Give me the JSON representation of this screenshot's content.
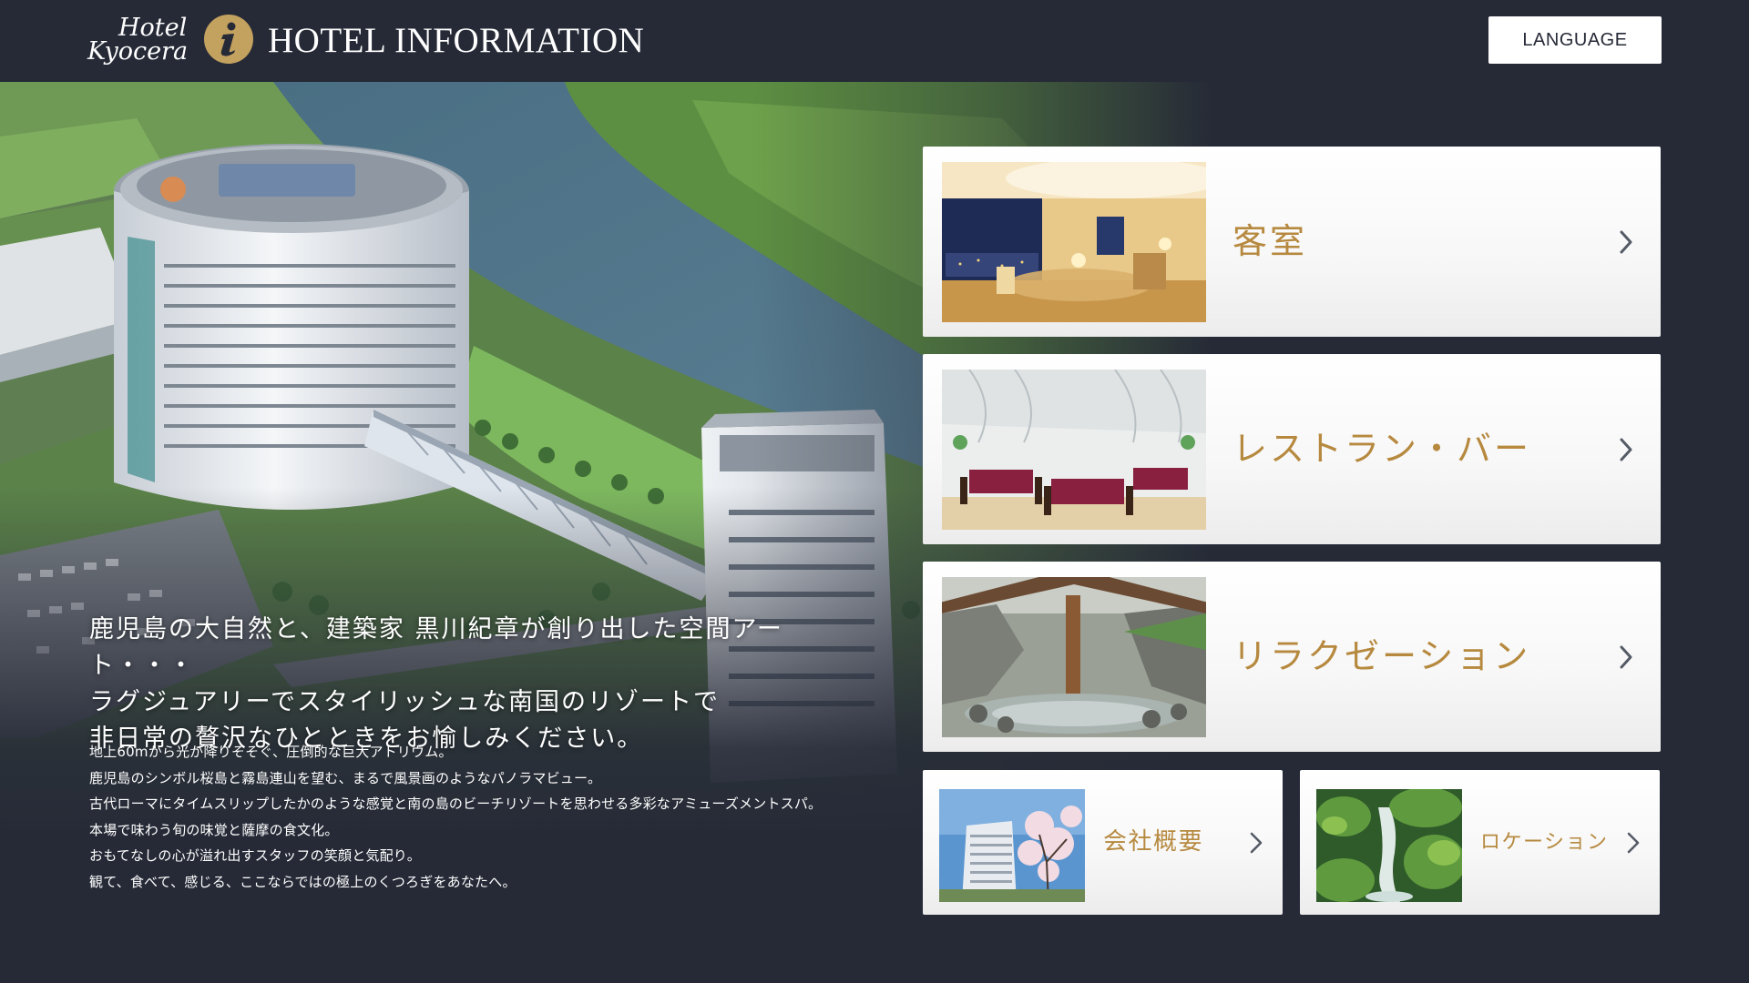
{
  "header": {
    "logo_line1": "Hotel",
    "logo_line2": "Kyocera",
    "info_icon": "info-icon",
    "title": "HOTEL INFORMATION",
    "language_button": "LANGUAGE"
  },
  "hero": {
    "catch_lines": [
      "鹿児島の大自然と、建築家 黒川紀章が創り出した空間アート・・・",
      "ラグジュアリーでスタイリッシュな南国のリゾートで",
      "非日常の贅沢なひとときをお愉しみください。"
    ],
    "description_lines": [
      "地上60mから光が降りそそぐ、圧倒的な巨大アトリウム。",
      "鹿児島のシンボル桜島と霧島連山を望む、まるで風景画のようなパノラマビュー。",
      "古代ローマにタイムスリップしたかのような感覚と南の島のビーチリゾートを思わせる多彩なアミューズメントスパ。",
      "本場で味わう旬の味覚と薩摩の食文化。",
      "おもてなしの心が溢れ出すスタッフの笑顔と気配り。",
      "観て、食べて、感じる、ここならではの極上のくつろぎをあなたへ。"
    ]
  },
  "menu": {
    "rooms": "客室",
    "restaurants": "レストラン・バー",
    "relaxation": "リラクゼーション",
    "company": "会社概要",
    "location": "ロケーション"
  },
  "colors": {
    "background": "#262a37",
    "accent_gold": "#c3a15e",
    "label_gold": "#b6893f",
    "card": "#ffffff"
  }
}
